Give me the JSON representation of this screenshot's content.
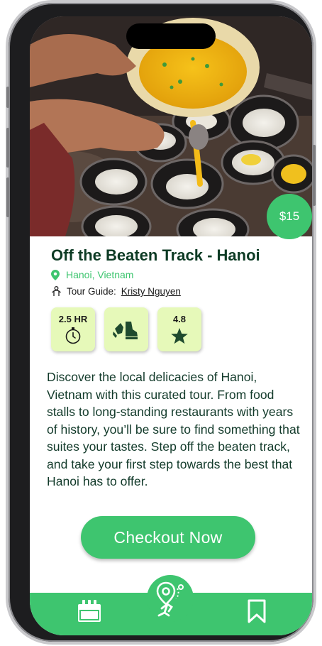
{
  "tour": {
    "title": "Off the Beaten Track - Hanoi",
    "location": "Hanoi, Vietnam",
    "guide_label": "Tour Guide:",
    "guide_name": "Kristy Nguyen",
    "price": "$15",
    "image_icon": "food-photo",
    "description": "Discover the local delicacies of Hanoi, Vietnam with this curated tour. From food stalls to long-standing restaurants with years of history, you’ll be sure to find something that suites your tastes. Step off the beaten track, and take your first step towards the best that Hanoi has to offer."
  },
  "stats": {
    "duration": "2.5 HR",
    "rating": "4.8",
    "duration_icon": "stopwatch-icon",
    "difficulty_icon": "footsteps-icon",
    "rating_icon": "star-icon"
  },
  "actions": {
    "checkout_label": "Checkout Now"
  },
  "nav": {
    "left_icon": "calendar-icon",
    "center_icon": "map-pin-walk-icon",
    "right_icon": "bookmark-icon"
  },
  "colors": {
    "accent": "#3ec56f",
    "title": "#0d3b24",
    "stat_bg": "#e6f9b9",
    "body_text": "#123a2a"
  }
}
